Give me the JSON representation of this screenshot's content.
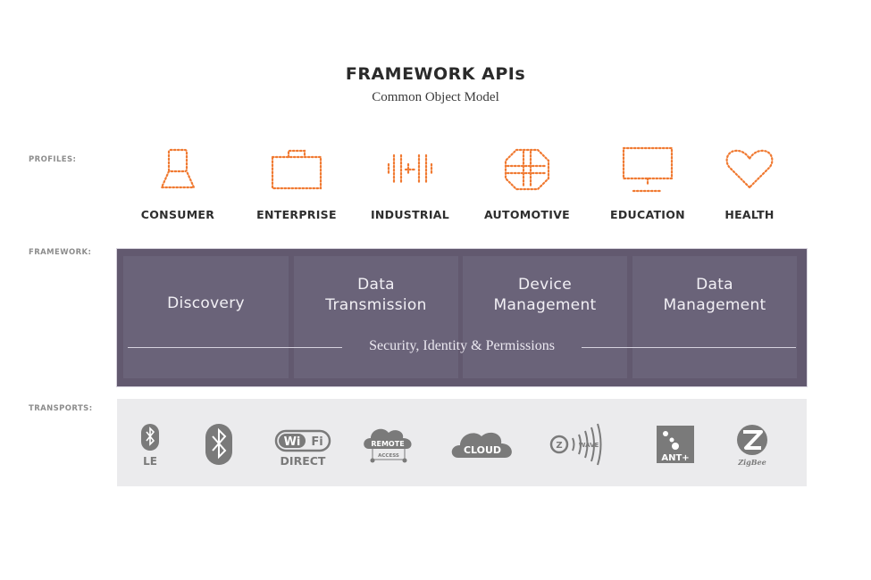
{
  "header": {
    "title": "FRAMEWORK APIs",
    "subtitle": "Common Object Model"
  },
  "row_labels": {
    "profiles": "PROFILES:",
    "framework": "FRAMEWORK:",
    "transports": "TRANSPORTS:"
  },
  "colors": {
    "accent_orange": "#f07a32",
    "framework_bg": "#62596f",
    "panel_bg": "#6a6379",
    "transport_bg": "#ebebed",
    "transport_icon": "#7a7a7a"
  },
  "profiles": [
    {
      "label": "CONSUMER",
      "icon": "person-icon"
    },
    {
      "label": "ENTERPRISE",
      "icon": "briefcase-icon"
    },
    {
      "label": "INDUSTRIAL",
      "icon": "industrial-gear-icon"
    },
    {
      "label": "AUTOMOTIVE",
      "icon": "steering-wheel-icon"
    },
    {
      "label": "EDUCATION",
      "icon": "monitor-icon"
    },
    {
      "label": "HEALTH",
      "icon": "heart-icon"
    }
  ],
  "framework": {
    "panels": [
      {
        "line1": "Discovery",
        "line2": ""
      },
      {
        "line1": "Data",
        "line2": "Transmission"
      },
      {
        "line1": "Device",
        "line2": "Management"
      },
      {
        "line1": "Data",
        "line2": "Management"
      }
    ],
    "security_label": "Security, Identity & Permissions"
  },
  "transports": [
    {
      "name": "bluetooth-le",
      "icon": "bluetooth-icon",
      "label": "LE"
    },
    {
      "name": "bluetooth",
      "icon": "bluetooth-icon",
      "label": ""
    },
    {
      "name": "wifi-direct",
      "icon": "wifi-logo-icon",
      "badge1": "Wi",
      "badge2": "Fi",
      "label": "DIRECT"
    },
    {
      "name": "remote-access",
      "icon": "cloud-icon",
      "badge1": "REMOTE",
      "label": "ACCESS"
    },
    {
      "name": "cloud",
      "icon": "cloud-icon",
      "label": "CLOUD"
    },
    {
      "name": "z-wave",
      "icon": "z-wave-icon",
      "badge1": "Z",
      "label": "WAVE"
    },
    {
      "name": "ant-plus",
      "icon": "ant-plus-icon",
      "label": "ANT+"
    },
    {
      "name": "zigbee",
      "icon": "zigbee-icon",
      "badge1": "Z",
      "label": "ZigBee"
    }
  ]
}
